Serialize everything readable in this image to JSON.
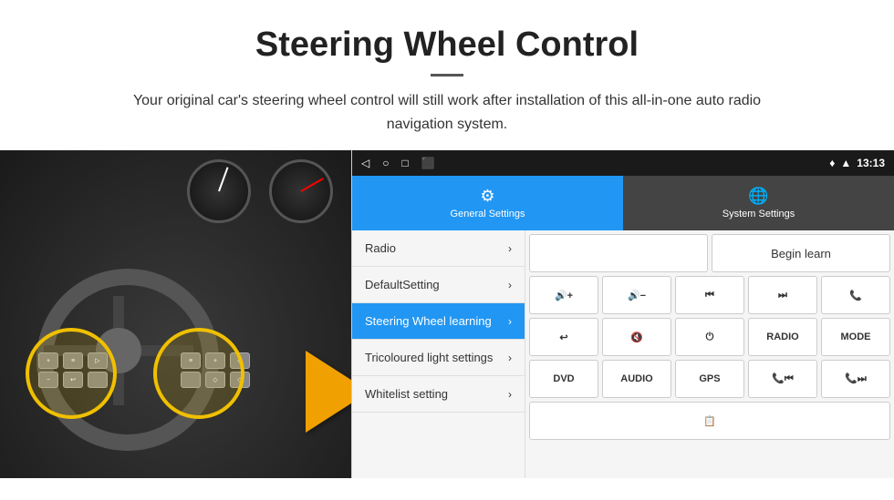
{
  "header": {
    "title": "Steering Wheel Control",
    "subtitle": "Your original car's steering wheel control will still work after installation of this all-in-one auto radio navigation system."
  },
  "status_bar": {
    "icons": [
      "◁",
      "○",
      "□",
      "⬛"
    ],
    "signal": "▾▴",
    "wifi": "◆",
    "time": "13:13"
  },
  "tabs": [
    {
      "label": "General Settings",
      "icon": "⚙",
      "active": true
    },
    {
      "label": "System Settings",
      "icon": "🌐",
      "active": false
    }
  ],
  "menu_items": [
    {
      "label": "Radio",
      "active": false
    },
    {
      "label": "DefaultSetting",
      "active": false
    },
    {
      "label": "Steering Wheel learning",
      "active": true
    },
    {
      "label": "Tricoloured light settings",
      "active": false
    },
    {
      "label": "Whitelist setting",
      "active": false
    }
  ],
  "control_panel": {
    "begin_learn_label": "Begin learn",
    "row1": [
      "",
      "Begin learn"
    ],
    "row2_icons": [
      "🔊+",
      "🔊−",
      "⏮",
      "⏭",
      "📞"
    ],
    "row3_icons": [
      "↩",
      "🔊✗",
      "⏻",
      "RADIO",
      "MODE"
    ],
    "row4_labels": [
      "DVD",
      "AUDIO",
      "GPS",
      "📞⏮",
      "📞⏭"
    ],
    "row5_labels": [
      "📋"
    ]
  }
}
